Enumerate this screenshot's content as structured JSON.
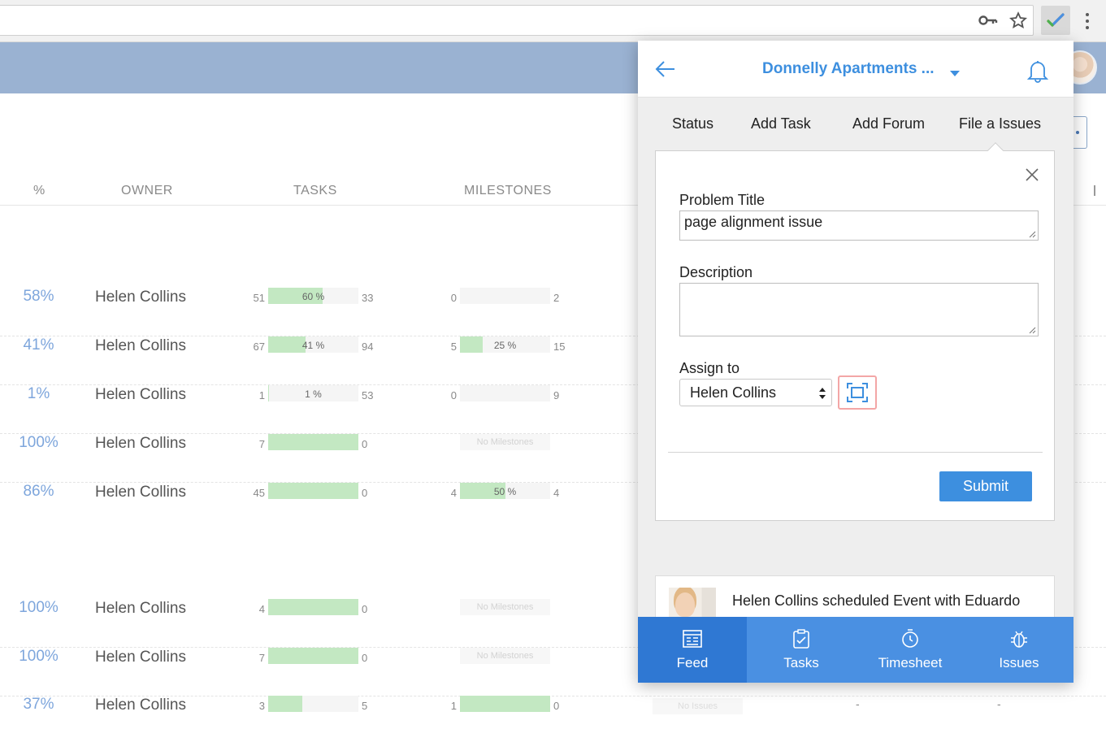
{
  "browser": {
    "icons": [
      "key-icon",
      "star-icon",
      "extension-check-icon",
      "menu-dots-icon"
    ]
  },
  "table": {
    "headers": {
      "pct": "%",
      "owner": "OWNER",
      "tasks": "TASKS",
      "milestones": "MILESTONES"
    },
    "rows": [
      {
        "pct": "58%",
        "owner": "Helen Collins",
        "tasks_left": "51",
        "tasks_bar_label": "60 %",
        "tasks_fill": 0.6,
        "tasks_right": "33",
        "ms_left": "0",
        "ms_bar_label": "",
        "ms_fill": 0,
        "ms_right": "2",
        "no_milestones": false
      },
      {
        "pct": "41%",
        "owner": "Helen Collins",
        "tasks_left": "67",
        "tasks_bar_label": "41 %",
        "tasks_fill": 0.41,
        "tasks_right": "94",
        "ms_left": "5",
        "ms_bar_label": "25 %",
        "ms_fill": 0.25,
        "ms_right": "15",
        "no_milestones": false
      },
      {
        "pct": "1%",
        "owner": "Helen Collins",
        "tasks_left": "1",
        "tasks_bar_label": "1 %",
        "tasks_fill": 0.01,
        "tasks_right": "53",
        "ms_left": "0",
        "ms_bar_label": "",
        "ms_fill": 0,
        "ms_right": "9",
        "no_milestones": false
      },
      {
        "pct": "100%",
        "owner": "Helen Collins",
        "tasks_left": "7",
        "tasks_bar_label": "",
        "tasks_fill": 1,
        "tasks_right": "0",
        "ms_left": "",
        "ms_bar_label": "No Milestones",
        "ms_fill": 0,
        "ms_right": "",
        "no_milestones": true
      },
      {
        "pct": "86%",
        "owner": "Helen Collins",
        "tasks_left": "45",
        "tasks_bar_label": "",
        "tasks_fill": 1,
        "tasks_right": "0",
        "ms_left": "4",
        "ms_bar_label": "50 %",
        "ms_fill": 0.5,
        "ms_right": "4",
        "no_milestones": false
      },
      {
        "pct": "100%",
        "owner": "Helen Collins",
        "tasks_left": "4",
        "tasks_bar_label": "",
        "tasks_fill": 1,
        "tasks_right": "0",
        "ms_left": "",
        "ms_bar_label": "No Milestones",
        "ms_fill": 0,
        "ms_right": "",
        "no_milestones": true
      },
      {
        "pct": "100%",
        "owner": "Helen Collins",
        "tasks_left": "7",
        "tasks_bar_label": "",
        "tasks_fill": 1,
        "tasks_right": "0",
        "ms_left": "",
        "ms_bar_label": "No Milestones",
        "ms_fill": 0,
        "ms_right": "",
        "no_milestones": true
      },
      {
        "pct": "37%",
        "owner": "Helen Collins",
        "tasks_left": "3",
        "tasks_bar_label": "",
        "tasks_fill": 0.375,
        "tasks_right": "5",
        "ms_left": "1",
        "ms_bar_label": "",
        "ms_fill": 1,
        "ms_right": "0",
        "no_milestones": false,
        "issues_label": "No Issues",
        "dash1": "-",
        "dash2": "-"
      }
    ]
  },
  "popup": {
    "project_title": "Donnelly Apartments ...",
    "tabs": [
      "Status",
      "Add Task",
      "Add Forum",
      "File a Issues"
    ],
    "form": {
      "problem_title_label": "Problem Title",
      "problem_title_value": "page alignment issue",
      "description_label": "Description",
      "description_value": "",
      "assign_label": "Assign to",
      "assign_value": "Helen Collins",
      "submit_label": "Submit"
    },
    "feed_item": "Helen Collins scheduled Event with Eduardo",
    "nav": [
      {
        "label": "Feed",
        "icon": "feed-icon",
        "active": true
      },
      {
        "label": "Tasks",
        "icon": "tasks-icon",
        "active": false
      },
      {
        "label": "Timesheet",
        "icon": "timesheet-icon",
        "active": false
      },
      {
        "label": "Issues",
        "icon": "issues-bug-icon",
        "active": false
      }
    ]
  },
  "colors": {
    "accent": "#3d8fdf",
    "header_band": "#9ab2d2",
    "progress_fill": "#c3e8c2",
    "percent_text": "#7ea6dc",
    "nav_bg": "#4a90e2",
    "nav_active": "#2f78d3"
  }
}
